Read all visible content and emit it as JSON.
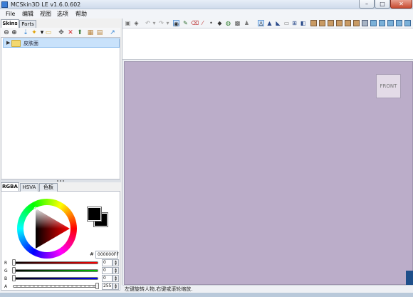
{
  "window": {
    "title": "MCSkin3D LE v1.6.0.602",
    "minimize": "–",
    "maximize": "□",
    "close": "✕"
  },
  "menu": {
    "items": [
      "File",
      "编辑",
      "视图",
      "选项",
      "帮助"
    ]
  },
  "left": {
    "tabs": [
      "Skins",
      "Parts"
    ],
    "toolbar_icons": [
      "zoom-out",
      "zoom-in",
      "import",
      "new-folder",
      "export",
      "folder",
      "move",
      "delete",
      "upload",
      "grid",
      "tile",
      "wand"
    ],
    "tree": {
      "item_label": "皮肤面"
    }
  },
  "color": {
    "tabs": [
      "RGBA",
      "HSVA",
      "色板"
    ],
    "hex_hash": "#",
    "hex_value": "000000FF",
    "channels": [
      {
        "label": "R",
        "value": "0"
      },
      {
        "label": "G",
        "value": "0"
      },
      {
        "label": "B",
        "value": "0"
      },
      {
        "label": "A",
        "value": "255"
      }
    ]
  },
  "viewport": {
    "front_label": "FRONT"
  },
  "status": {
    "text": "左键旋转人物,右键或滚轮缩放."
  }
}
